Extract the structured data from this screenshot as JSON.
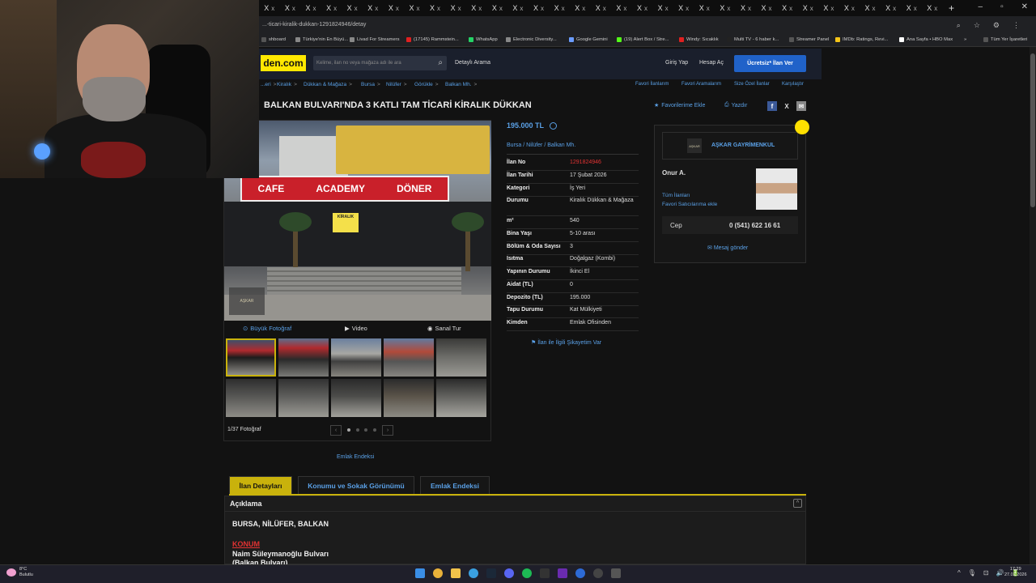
{
  "browser": {
    "tab_glyph": "X",
    "tab_close": "x",
    "new_tab": "+",
    "url": "...-ticari-kiralik-dukkan-1291824946/detay",
    "window_controls": [
      "–",
      "▫",
      "✕"
    ],
    "addr_icons": [
      "⌕",
      "☆",
      "⚙",
      "⋮"
    ],
    "bookmarks": [
      {
        "label": "shboard",
        "color": "#555555"
      },
      {
        "label": "Türkiye'nin En Büyü...",
        "color": "#888888"
      },
      {
        "label": "Livad For Streamers",
        "color": "#888888"
      },
      {
        "label": "(17145) Rammstein...",
        "color": "#e02020"
      },
      {
        "label": "WhatsApp",
        "color": "#25d366"
      },
      {
        "label": "Electronic Diversity...",
        "color": "#888888"
      },
      {
        "label": "Google Gemini",
        "color": "#6b9cff"
      },
      {
        "label": "(19) Alert Box / Stre...",
        "color": "#53fc18"
      },
      {
        "label": "Windy: Sıcaklık",
        "color": "#e02020"
      },
      {
        "label": "Multi TV - 6 haber k...",
        "color": "#222222"
      },
      {
        "label": "Streamer Panel",
        "color": "#555555"
      },
      {
        "label": "IMDb: Ratings, Revi...",
        "color": "#f5c518"
      },
      {
        "label": "Ana Sayfa • HBO Max",
        "color": "#ffffff"
      },
      {
        "label": "»",
        "color": ""
      },
      {
        "label": "Tüm Yer İşaretleri",
        "color": "#555555"
      }
    ]
  },
  "site": {
    "logo": "den.com",
    "search_placeholder": "Kelime, ilan no veya mağaza adı ile ara",
    "search_icon": "⌕",
    "detailed_search": "Detaylı Arama",
    "login": "Giriş Yap",
    "register": "Hesap Aç",
    "post_ad": "Ücretsiz* İlan Ver",
    "breadcrumb": [
      "...eri",
      "Kiralık",
      "Dükkan & Mağaza",
      "Bursa",
      "Nilüfer",
      "Görükle",
      "Balkan Mh."
    ],
    "breadcrumb_sep": ">",
    "top_links": [
      "Favori İlanlarım",
      "Favori Aramalarım",
      "Size Özel İlanlar",
      "Karşılaştır"
    ],
    "title": "BALKAN BULVARI'NDA 3 KATLI TAM TİCARİ KİRALIK DÜKKAN",
    "add_favorite": "Favorilerime Ekle",
    "print": "Yazdır",
    "share": [
      "f",
      "X",
      "✉"
    ]
  },
  "photo": {
    "sign_words": [
      "CAFE",
      "ACADEMY",
      "DÖNER"
    ],
    "kiralik_sign": "KİRALIK",
    "logo_text": "AŞKAR",
    "big_photo": "Büyük Fotoğraf",
    "video": "Video",
    "virtual_tour": "Sanal Tur",
    "count": "1/37 Fotoğraf",
    "prev": "‹",
    "next": "›",
    "emlak_endeksi": "Emlak Endeksi"
  },
  "listing": {
    "price": "195.000 TL",
    "location": [
      "Bursa",
      "Nilüfer",
      "Balkan Mh."
    ],
    "location_sep": "/",
    "rows": [
      {
        "k": "İlan No",
        "v": "1291824946"
      },
      {
        "k": "İlan Tarihi",
        "v": "17 Şubat 2026"
      },
      {
        "k": "Kategori",
        "v": "İş Yeri"
      },
      {
        "k": "Durumu",
        "v": "Kiralık Dükkan & Mağaza"
      },
      {
        "k": "m²",
        "v": "540"
      },
      {
        "k": "Bina Yaşı",
        "v": "5-10 arası"
      },
      {
        "k": "Bölüm & Oda Sayısı",
        "v": "3"
      },
      {
        "k": "Isıtma",
        "v": "Doğalgaz (Kombi)"
      },
      {
        "k": "Yapının Durumu",
        "v": "İkinci El"
      },
      {
        "k": "Aidat (TL)",
        "v": "0"
      },
      {
        "k": "Depozito (TL)",
        "v": "195.000"
      },
      {
        "k": "Tapu Durumu",
        "v": "Kat Mülkiyeti"
      },
      {
        "k": "Kimden",
        "v": "Emlak Ofisinden"
      }
    ],
    "complaint": "İlan ile İlgili Şikayetim Var"
  },
  "seller": {
    "company": "AŞKAR GAYRİMENKUL",
    "logo_text": "AŞKAR",
    "agent": "Onur A.",
    "all_listings": "Tüm İlanları",
    "favorite_seller": "Favori Satıcılarıma ekle",
    "cep_label": "Cep",
    "phone": "0 (541) 622 16 61",
    "message": "Mesaj gönder"
  },
  "detail_tabs": [
    "İlan Detayları",
    "Konumu ve Sokak Görünümü",
    "Emlak Endeksi"
  ],
  "description": {
    "heading": "Açıklama",
    "collapse": "^",
    "line1": "BURSA, NİLÜFER, BALKAN",
    "konum": "KONUM",
    "line2": "Naim Süleymanoğlu Bulvarı",
    "line3": "(Balkan Bulvarı)"
  },
  "taskbar": {
    "temp": "8°C",
    "weather": "Bulutlu",
    "tray": [
      "^",
      "🎙",
      "⊡",
      "🔊",
      "🔋"
    ],
    "time": "17:29",
    "date": "27.02.2026"
  },
  "colors": {
    "accent_blue": "#5aa0e6",
    "brand_yellow": "#ffe800",
    "post_button": "#2062c9",
    "sign_red": "#c9202a",
    "tab_active": "#c9b20c"
  }
}
